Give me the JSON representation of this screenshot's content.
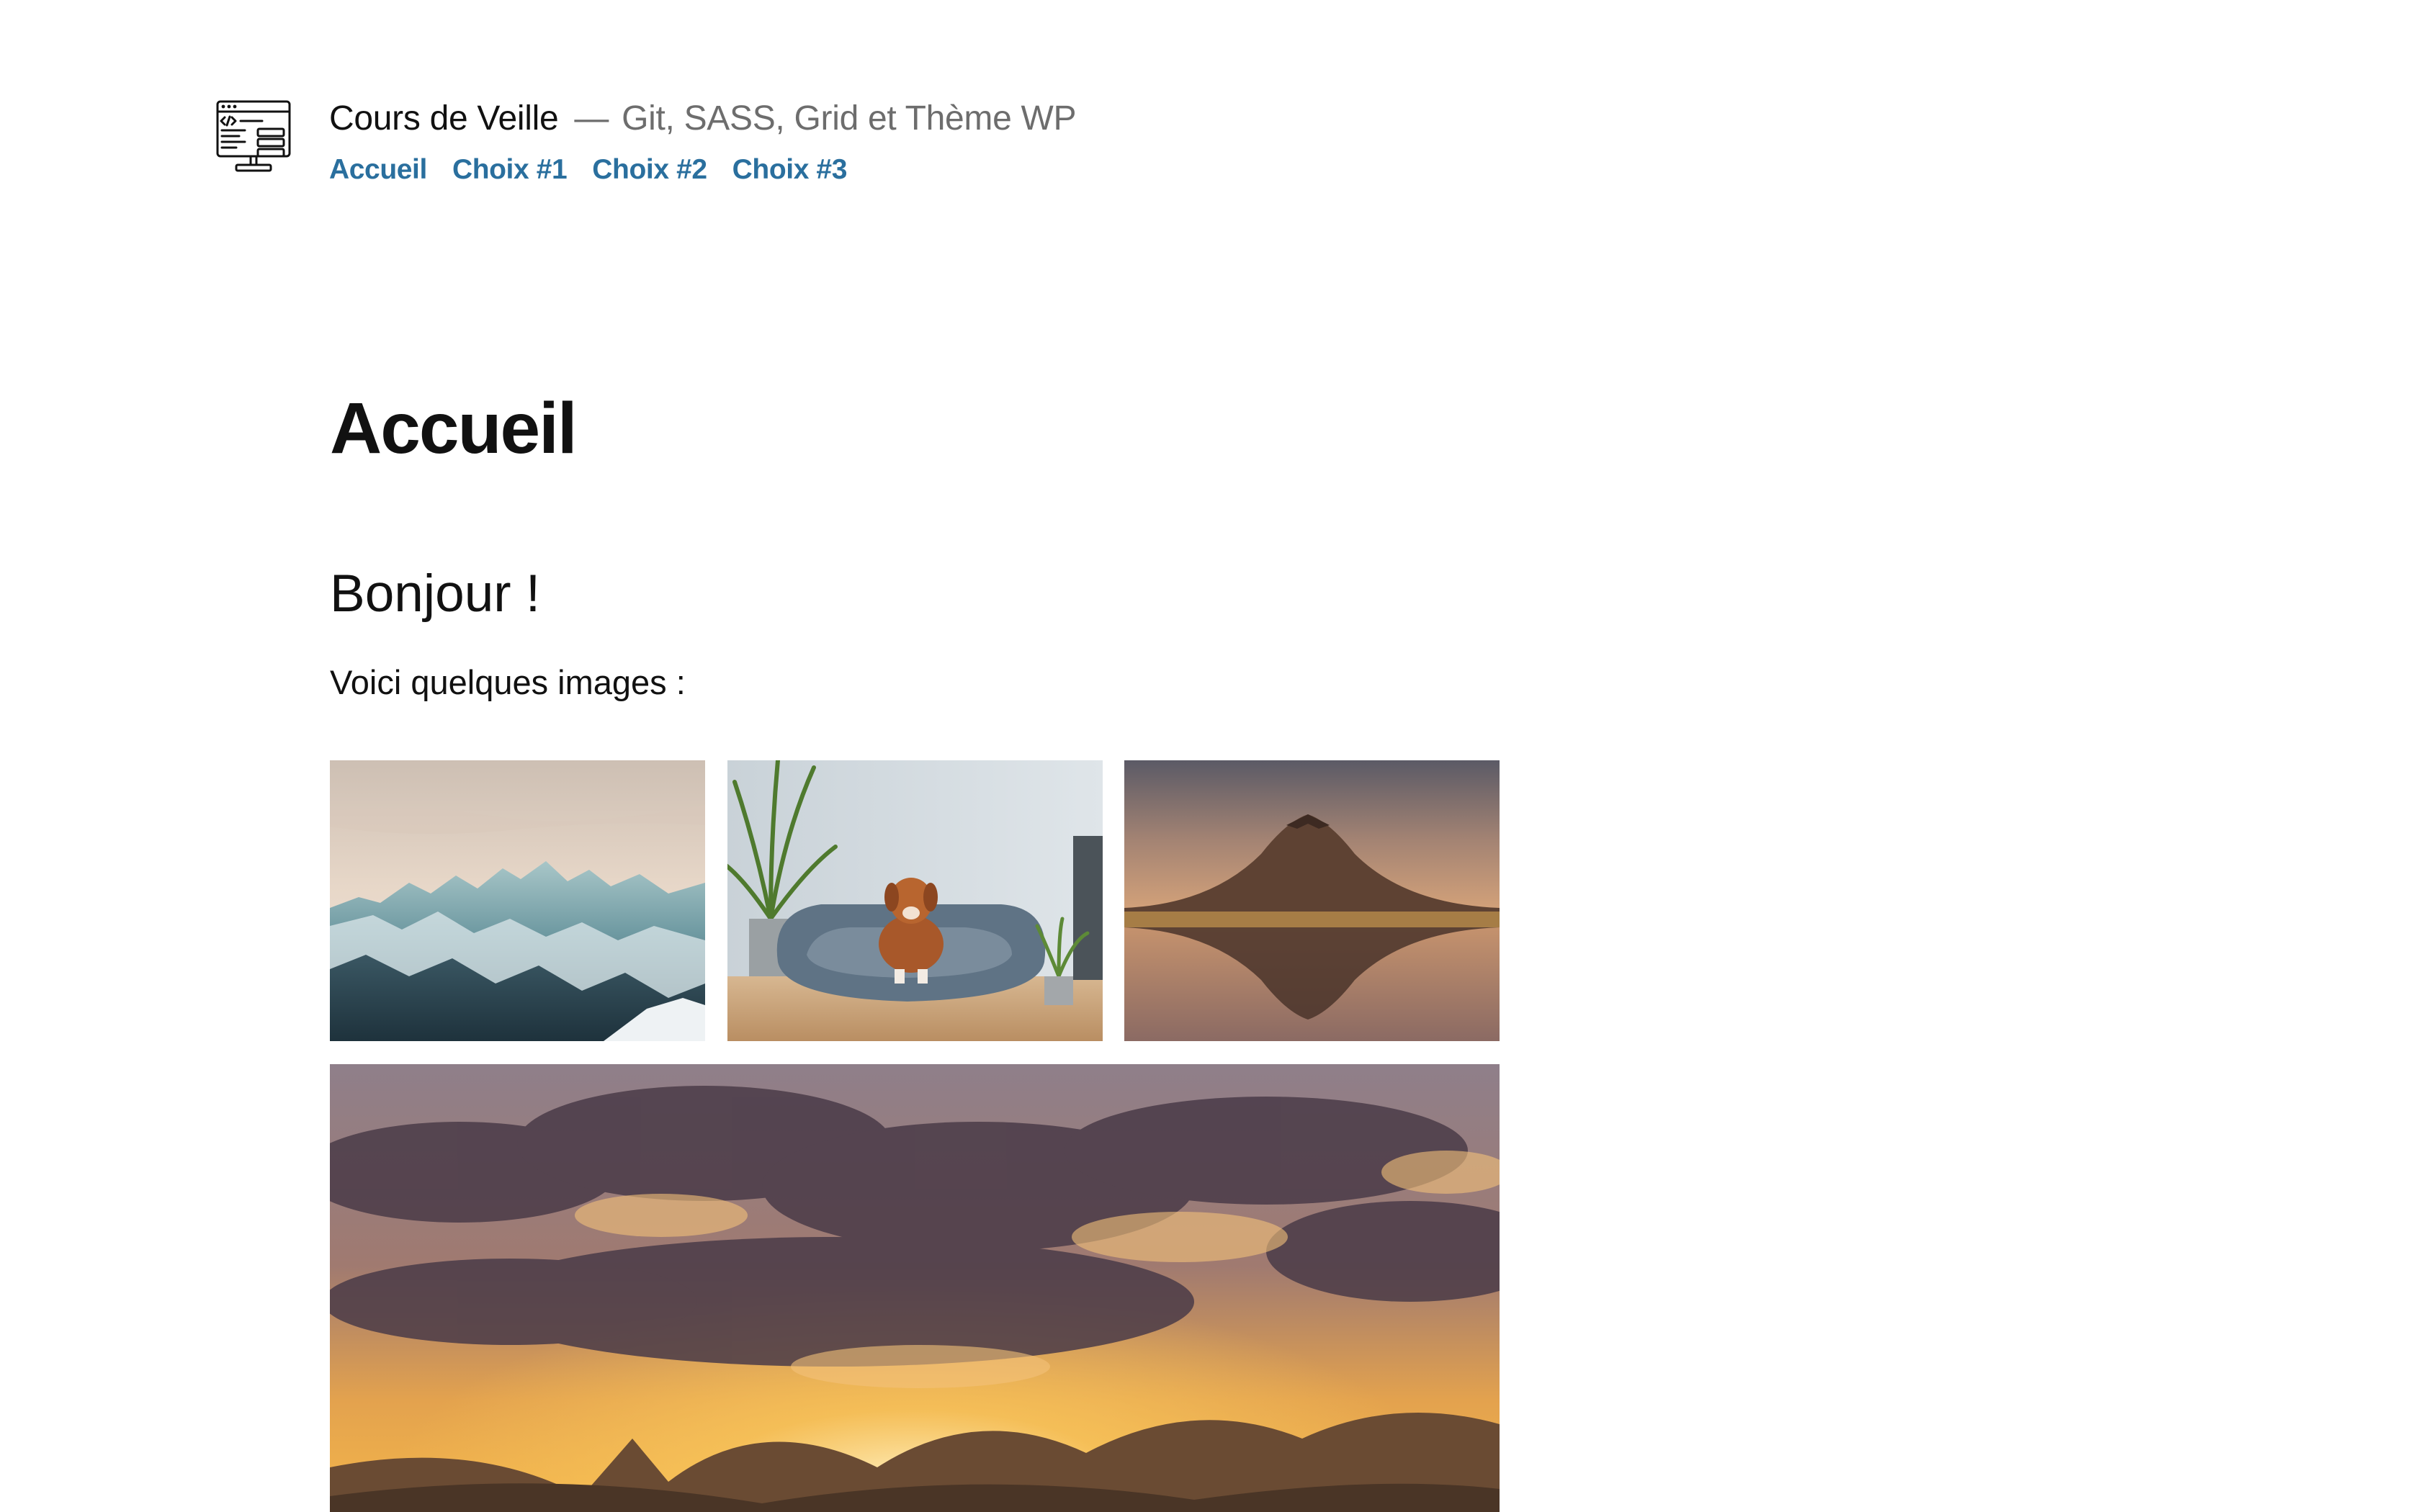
{
  "site": {
    "title": "Cours de Veille",
    "separator": "—",
    "description": "Git, SASS, Grid et Thème WP",
    "logo_icon": "code-monitor-icon"
  },
  "nav": {
    "items": [
      {
        "label": "Accueil"
      },
      {
        "label": "Choix #1"
      },
      {
        "label": "Choix #2"
      },
      {
        "label": "Choix #3"
      }
    ],
    "link_color": "#2a6f9e"
  },
  "page": {
    "title": "Accueil",
    "heading": "Bonjour !",
    "intro": "Voici quelques images :"
  },
  "gallery": {
    "images": [
      {
        "subject": "snowy-mountain-range"
      },
      {
        "subject": "dog-in-pet-bed"
      },
      {
        "subject": "volcano-reflection-lake"
      },
      {
        "subject": "sunset-clouds-mountains"
      }
    ]
  },
  "colors": {
    "text": "#111111",
    "muted": "#6d6d6d",
    "link": "#2a6f9e"
  }
}
